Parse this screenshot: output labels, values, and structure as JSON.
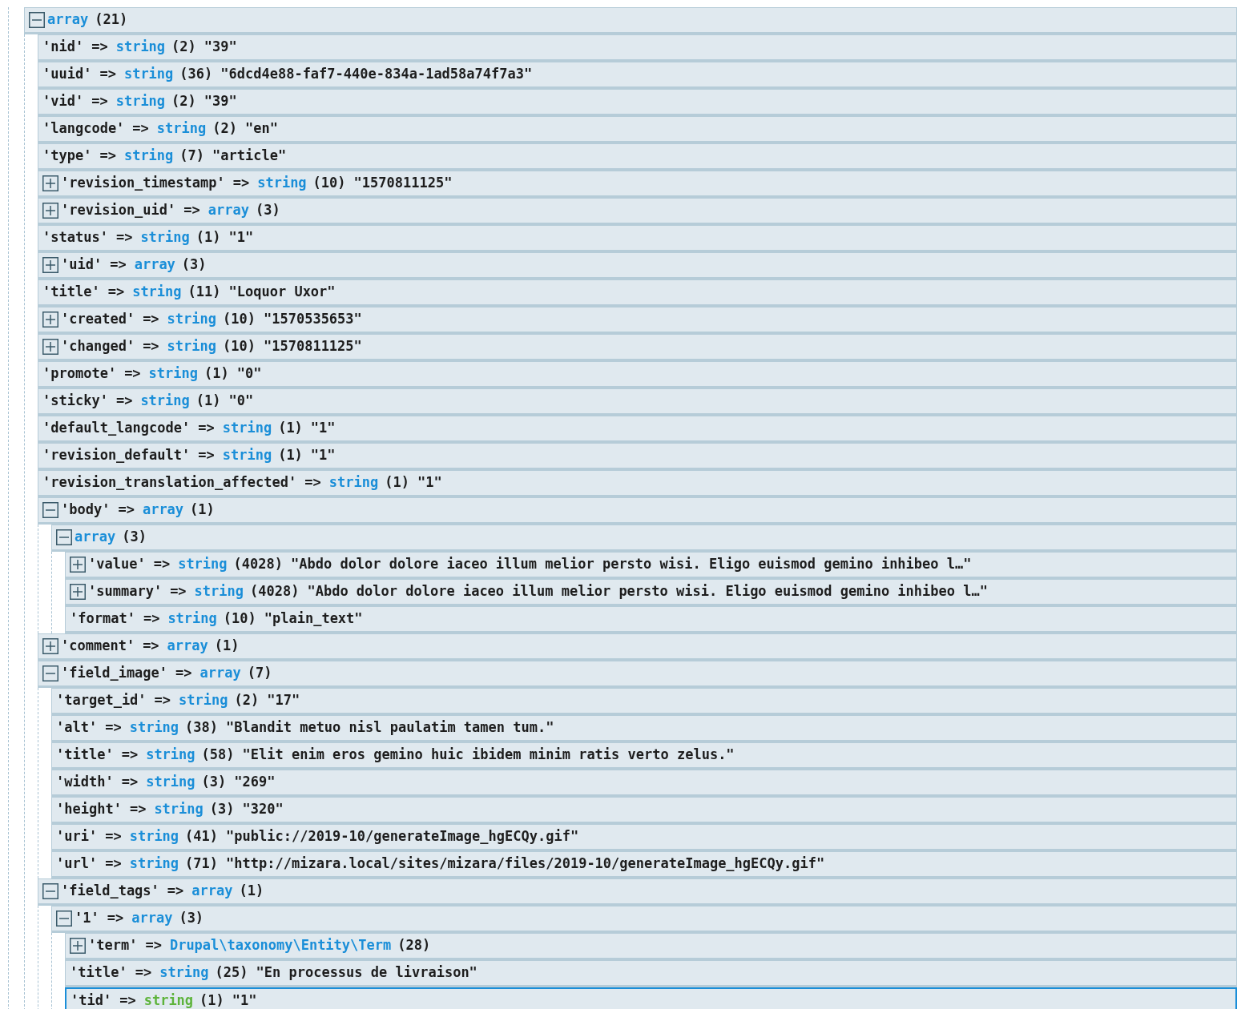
{
  "dump": {
    "kind": "branch",
    "expanded": true,
    "selected": false,
    "type": "array",
    "size": "(21)",
    "children": [
      {
        "kind": "leaf",
        "selected": false,
        "key": "'nid'",
        "arrow": "=>",
        "type": "string",
        "size": "(2)",
        "value": "\"39\""
      },
      {
        "kind": "leaf",
        "selected": false,
        "key": "'uuid'",
        "arrow": "=>",
        "type": "string",
        "size": "(36)",
        "value": "\"6dcd4e88-faf7-440e-834a-1ad58a74f7a3\""
      },
      {
        "kind": "leaf",
        "selected": false,
        "key": "'vid'",
        "arrow": "=>",
        "type": "string",
        "size": "(2)",
        "value": "\"39\""
      },
      {
        "kind": "leaf",
        "selected": false,
        "key": "'langcode'",
        "arrow": "=>",
        "type": "string",
        "size": "(2)",
        "value": "\"en\""
      },
      {
        "kind": "leaf",
        "selected": false,
        "key": "'type'",
        "arrow": "=>",
        "type": "string",
        "size": "(7)",
        "value": "\"article\""
      },
      {
        "kind": "branch",
        "expanded": false,
        "selected": false,
        "key": "'revision_timestamp'",
        "arrow": "=>",
        "type": "string",
        "size": "(10)",
        "value": "\"1570811125\""
      },
      {
        "kind": "branch",
        "expanded": false,
        "selected": false,
        "key": "'revision_uid'",
        "arrow": "=>",
        "type": "array",
        "size": "(3)"
      },
      {
        "kind": "leaf",
        "selected": false,
        "key": "'status'",
        "arrow": "=>",
        "type": "string",
        "size": "(1)",
        "value": "\"1\""
      },
      {
        "kind": "branch",
        "expanded": false,
        "selected": false,
        "key": "'uid'",
        "arrow": "=>",
        "type": "array",
        "size": "(3)"
      },
      {
        "kind": "leaf",
        "selected": false,
        "key": "'title'",
        "arrow": "=>",
        "type": "string",
        "size": "(11)",
        "value": "\"Loquor Uxor\""
      },
      {
        "kind": "branch",
        "expanded": false,
        "selected": false,
        "key": "'created'",
        "arrow": "=>",
        "type": "string",
        "size": "(10)",
        "value": "\"1570535653\""
      },
      {
        "kind": "branch",
        "expanded": false,
        "selected": false,
        "key": "'changed'",
        "arrow": "=>",
        "type": "string",
        "size": "(10)",
        "value": "\"1570811125\""
      },
      {
        "kind": "leaf",
        "selected": false,
        "key": "'promote'",
        "arrow": "=>",
        "type": "string",
        "size": "(1)",
        "value": "\"0\""
      },
      {
        "kind": "leaf",
        "selected": false,
        "key": "'sticky'",
        "arrow": "=>",
        "type": "string",
        "size": "(1)",
        "value": "\"0\""
      },
      {
        "kind": "leaf",
        "selected": false,
        "key": "'default_langcode'",
        "arrow": "=>",
        "type": "string",
        "size": "(1)",
        "value": "\"1\""
      },
      {
        "kind": "leaf",
        "selected": false,
        "key": "'revision_default'",
        "arrow": "=>",
        "type": "string",
        "size": "(1)",
        "value": "\"1\""
      },
      {
        "kind": "leaf",
        "selected": false,
        "key": "'revision_translation_affected'",
        "arrow": "=>",
        "type": "string",
        "size": "(1)",
        "value": "\"1\""
      },
      {
        "kind": "branch",
        "expanded": true,
        "selected": false,
        "key": "'body'",
        "arrow": "=>",
        "type": "array",
        "size": "(1)",
        "children": [
          {
            "kind": "branch",
            "expanded": true,
            "selected": false,
            "type": "array",
            "size": "(3)",
            "children": [
              {
                "kind": "branch",
                "expanded": false,
                "selected": false,
                "key": "'value'",
                "arrow": "=>",
                "type": "string",
                "size": "(4028)",
                "value": "\"Abdo dolor dolore iaceo illum melior persto wisi. Eligo euismod gemino inhibeo l…\""
              },
              {
                "kind": "branch",
                "expanded": false,
                "selected": false,
                "key": "'summary'",
                "arrow": "=>",
                "type": "string",
                "size": "(4028)",
                "value": "\"Abdo dolor dolore iaceo illum melior persto wisi. Eligo euismod gemino inhibeo l…\""
              },
              {
                "kind": "leaf",
                "selected": false,
                "key": "'format'",
                "arrow": "=>",
                "type": "string",
                "size": "(10)",
                "value": "\"plain_text\""
              }
            ]
          }
        ]
      },
      {
        "kind": "branch",
        "expanded": false,
        "selected": false,
        "key": "'comment'",
        "arrow": "=>",
        "type": "array",
        "size": "(1)"
      },
      {
        "kind": "branch",
        "expanded": true,
        "selected": false,
        "key": "'field_image'",
        "arrow": "=>",
        "type": "array",
        "size": "(7)",
        "children": [
          {
            "kind": "leaf",
            "selected": false,
            "key": "'target_id'",
            "arrow": "=>",
            "type": "string",
            "size": "(2)",
            "value": "\"17\""
          },
          {
            "kind": "leaf",
            "selected": false,
            "key": "'alt'",
            "arrow": "=>",
            "type": "string",
            "size": "(38)",
            "value": "\"Blandit metuo nisl paulatim tamen tum.\""
          },
          {
            "kind": "leaf",
            "selected": false,
            "key": "'title'",
            "arrow": "=>",
            "type": "string",
            "size": "(58)",
            "value": "\"Elit enim eros gemino huic ibidem minim ratis verto zelus.\""
          },
          {
            "kind": "leaf",
            "selected": false,
            "key": "'width'",
            "arrow": "=>",
            "type": "string",
            "size": "(3)",
            "value": "\"269\""
          },
          {
            "kind": "leaf",
            "selected": false,
            "key": "'height'",
            "arrow": "=>",
            "type": "string",
            "size": "(3)",
            "value": "\"320\""
          },
          {
            "kind": "leaf",
            "selected": false,
            "key": "'uri'",
            "arrow": "=>",
            "type": "string",
            "size": "(41)",
            "value": "\"public://2019-10/generateImage_hgECQy.gif\""
          },
          {
            "kind": "leaf",
            "selected": false,
            "key": "'url'",
            "arrow": "=>",
            "type": "string",
            "size": "(71)",
            "value": "\"http://mizara.local/sites/mizara/files/2019-10/generateImage_hgECQy.gif\""
          }
        ]
      },
      {
        "kind": "branch",
        "expanded": true,
        "selected": false,
        "key": "'field_tags'",
        "arrow": "=>",
        "type": "array",
        "size": "(1)",
        "children": [
          {
            "kind": "branch",
            "expanded": true,
            "selected": false,
            "key": "'1'",
            "arrow": "=>",
            "type": "array",
            "size": "(3)",
            "children": [
              {
                "kind": "branch",
                "expanded": false,
                "selected": false,
                "key": "'term'",
                "arrow": "=>",
                "type": "Drupal\\taxonomy\\Entity\\Term",
                "size": "(28)"
              },
              {
                "kind": "leaf",
                "selected": false,
                "key": "'title'",
                "arrow": "=>",
                "type": "string",
                "size": "(25)",
                "value": "\"En processus de livraison\""
              },
              {
                "kind": "leaf",
                "selected": true,
                "key": "'tid'",
                "arrow": "=>",
                "type": "string",
                "size": "(1)",
                "value": "\"1\""
              }
            ]
          }
        ]
      }
    ]
  }
}
